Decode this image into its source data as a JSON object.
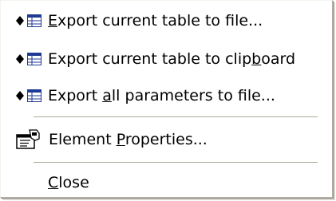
{
  "menu": {
    "items": [
      {
        "label_pre": "",
        "label_accel": "E",
        "label_post": "xport current table to file...",
        "icon": "table-export-icon"
      },
      {
        "label_pre": "Export current table to clip",
        "label_accel": "b",
        "label_post": "oard",
        "icon": "table-export-icon"
      },
      {
        "label_pre": "Export ",
        "label_accel": "a",
        "label_post": "ll parameters to file...",
        "icon": "table-export-icon"
      },
      {
        "label_pre": "Element ",
        "label_accel": "P",
        "label_post": "roperties...",
        "icon": "properties-icon"
      },
      {
        "label_pre": "",
        "label_accel": "C",
        "label_post": "lose",
        "icon": ""
      }
    ]
  },
  "colors": {
    "menu_background": "#ffffff",
    "separator": "#aca899",
    "diamond": "#000000",
    "table_icon_border": "#1f3a93"
  }
}
